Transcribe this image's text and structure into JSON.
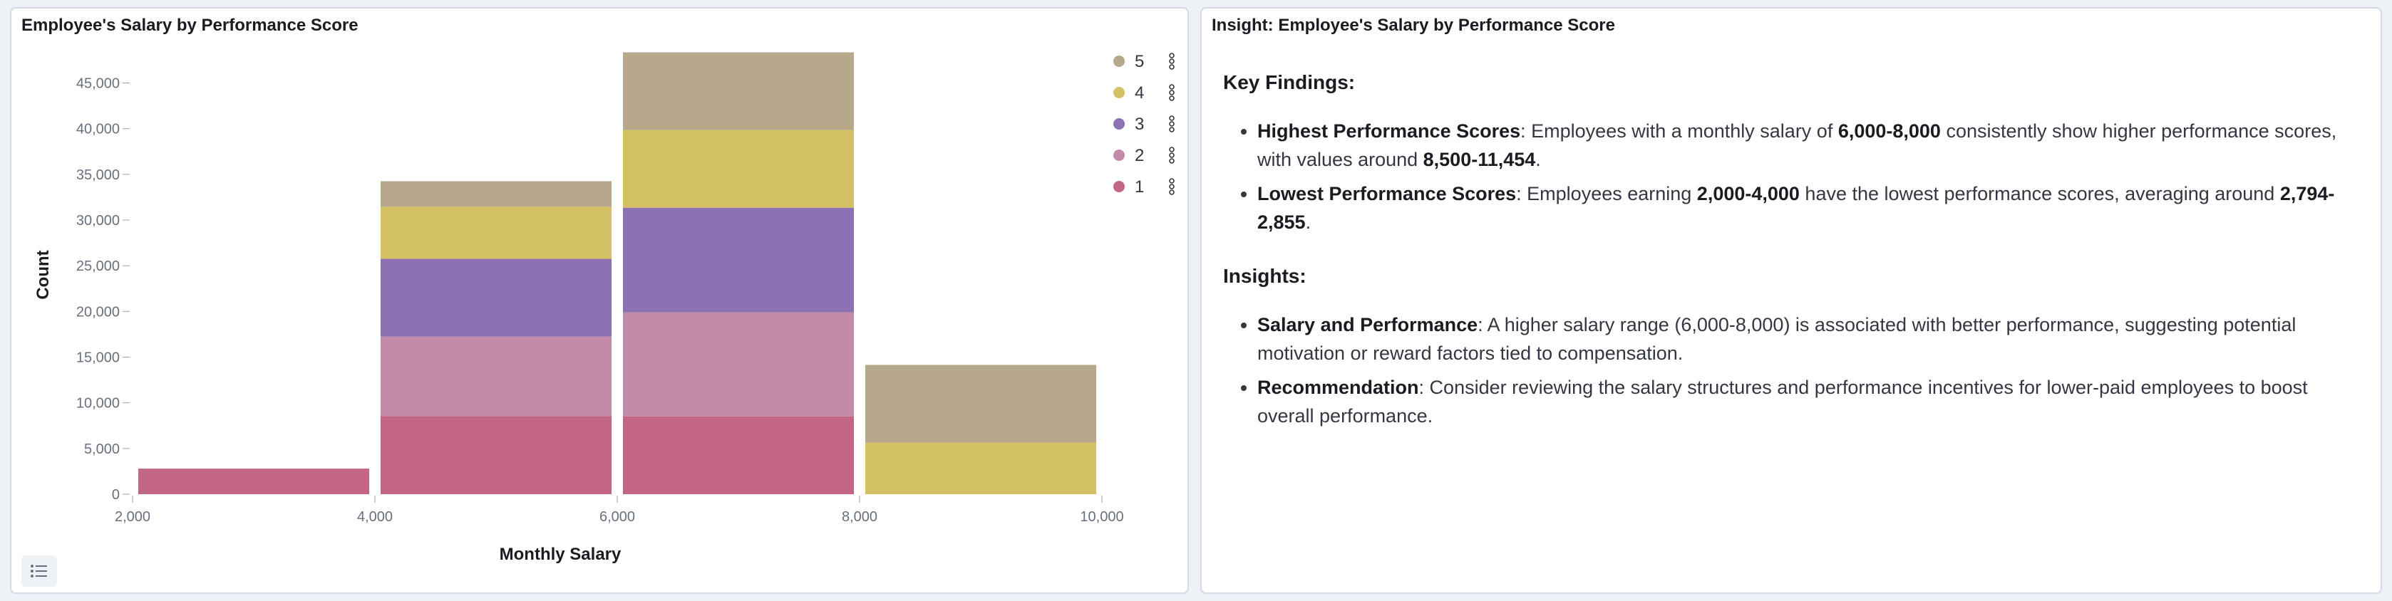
{
  "left_panel": {
    "title": "Employee's Salary by Performance Score"
  },
  "right_panel": {
    "title": "Insight: Employee's Salary by Performance Score",
    "sections": [
      {
        "heading": "Key Findings:",
        "items": [
          {
            "parts": [
              {
                "text": "Highest Performance Scores",
                "bold": true
              },
              {
                "text": ": Employees with a monthly salary of ",
                "bold": false
              },
              {
                "text": "6,000-8,000",
                "bold": true
              },
              {
                "text": " consistently show higher performance scores, with values around ",
                "bold": false
              },
              {
                "text": "8,500-11,454",
                "bold": true
              },
              {
                "text": ".",
                "bold": false
              }
            ]
          },
          {
            "parts": [
              {
                "text": "Lowest Performance Scores",
                "bold": true
              },
              {
                "text": ": Employees earning ",
                "bold": false
              },
              {
                "text": "2,000-4,000",
                "bold": true
              },
              {
                "text": " have the lowest performance scores, averaging around ",
                "bold": false
              },
              {
                "text": "2,794-2,855",
                "bold": true
              },
              {
                "text": ".",
                "bold": false
              }
            ]
          }
        ]
      },
      {
        "heading": "Insights:",
        "items": [
          {
            "parts": [
              {
                "text": "Salary and Performance",
                "bold": true
              },
              {
                "text": ": A higher salary range (6,000-8,000) is associated with better performance, suggesting potential motivation or reward factors tied to compensation.",
                "bold": false
              }
            ]
          },
          {
            "parts": [
              {
                "text": "Recommendation",
                "bold": true
              },
              {
                "text": ": Consider reviewing the salary structures and performance incentives for lower-paid employees to boost overall performance.",
                "bold": false
              }
            ]
          }
        ]
      }
    ]
  },
  "icons": {
    "legend_toggle": "list-icon",
    "legend_item_menu": "vertical-dots-icon"
  },
  "chart_data": {
    "type": "bar",
    "stacked": true,
    "xlabel": "Monthly Salary",
    "ylabel": "Count",
    "x_ticks": [
      "2,000",
      "4,000",
      "6,000",
      "8,000",
      "10,000"
    ],
    "y_ticks": [
      "0",
      "5,000",
      "10,000",
      "15,000",
      "20,000",
      "25,000",
      "30,000",
      "35,000",
      "40,000",
      "45,000"
    ],
    "xlim": [
      2000,
      10000
    ],
    "ylim": [
      0,
      48000
    ],
    "bins": [
      [
        2000,
        4000
      ],
      [
        4000,
        6000
      ],
      [
        6000,
        8000
      ],
      [
        8000,
        10000
      ]
    ],
    "series": [
      {
        "name": "1",
        "color": "#c36683",
        "values": [
          2800,
          8550,
          8500,
          0
        ]
      },
      {
        "name": "2",
        "color": "#c38ba8",
        "values": [
          0,
          8700,
          11400,
          0
        ]
      },
      {
        "name": "3",
        "color": "#8c72b4",
        "values": [
          0,
          8500,
          11450,
          0
        ]
      },
      {
        "name": "4",
        "color": "#d3c163",
        "values": [
          0,
          5700,
          8500,
          5650
        ]
      },
      {
        "name": "5",
        "color": "#b8a88b",
        "values": [
          0,
          2800,
          8500,
          8500
        ]
      }
    ],
    "legend": {
      "position": "top-right",
      "order": [
        "5",
        "4",
        "3",
        "2",
        "1"
      ]
    },
    "grid": false
  }
}
